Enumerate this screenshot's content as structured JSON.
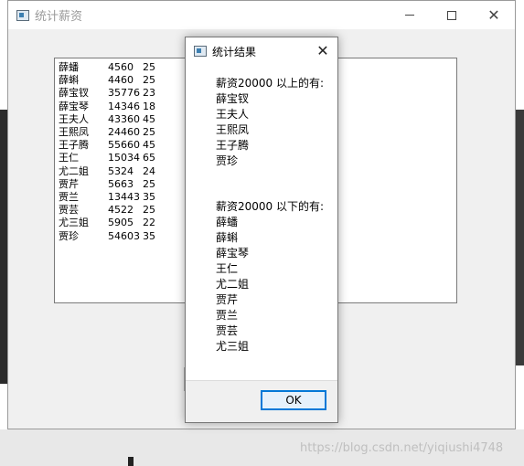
{
  "main_window": {
    "title": "统计薪资",
    "employees": [
      {
        "name": "薛蟠",
        "salary": "4560",
        "age": "25"
      },
      {
        "name": "薛蝌",
        "salary": "4460",
        "age": "25"
      },
      {
        "name": "薛宝钗",
        "salary": "35776",
        "age": "23"
      },
      {
        "name": "薛宝琴",
        "salary": "14346",
        "age": "18"
      },
      {
        "name": "王夫人",
        "salary": "43360",
        "age": "45"
      },
      {
        "name": "王熙凤",
        "salary": "24460",
        "age": "25"
      },
      {
        "name": "王子腾",
        "salary": "55660",
        "age": "45"
      },
      {
        "name": "王仁",
        "salary": "15034",
        "age": "65"
      },
      {
        "name": "尤二姐",
        "salary": "5324",
        "age": "24"
      },
      {
        "name": "贾芹",
        "salary": "5663",
        "age": "25"
      },
      {
        "name": "贾兰",
        "salary": "13443",
        "age": "35"
      },
      {
        "name": "贾芸",
        "salary": "4522",
        "age": "25"
      },
      {
        "name": "尤三姐",
        "salary": "5905",
        "age": "22"
      },
      {
        "name": "贾珍",
        "salary": "54603",
        "age": "35"
      }
    ]
  },
  "dialog": {
    "title": "统计结果",
    "above_header": "薪资20000 以上的有:",
    "above": [
      "薛宝钗",
      "王夫人",
      "王熙凤",
      "王子腾",
      "贾珍"
    ],
    "below_header": "薪资20000 以下的有:",
    "below": [
      "薛蟠",
      "薛蝌",
      "薛宝琴",
      "王仁",
      "尤二姐",
      "贾芹",
      "贾兰",
      "贾芸",
      "尤三姐"
    ],
    "ok_label": "OK"
  },
  "watermark": "https://blog.csdn.net/yiqiushi4748"
}
